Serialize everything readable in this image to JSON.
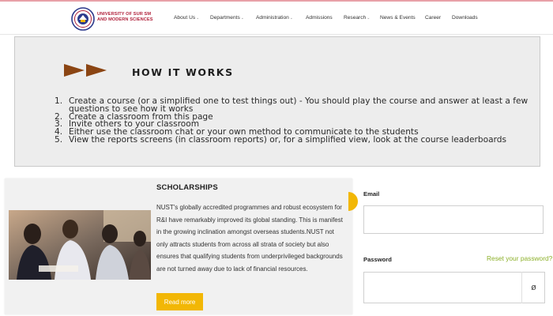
{
  "header": {
    "logo_text_line1": "UNIVERSITY OF SUR SM",
    "logo_text_line2": "AND MODERN SCIENCES",
    "nav": [
      {
        "label": "About Us",
        "has_menu": true
      },
      {
        "label": "Departments",
        "has_menu": true
      },
      {
        "label": "Administration",
        "has_menu": true
      },
      {
        "label": "Admissions",
        "has_menu": false
      },
      {
        "label": "Research",
        "has_menu": true
      },
      {
        "label": "News & Events",
        "has_menu": false
      },
      {
        "label": "Career",
        "has_menu": false
      },
      {
        "label": "Downloads",
        "has_menu": false
      }
    ]
  },
  "how_it_works": {
    "title": "HOW IT WORKS",
    "steps": [
      {
        "num": "1.",
        "text": "Create a course (or a simplified one to test things out) - You should play the course and answer at least a few questions to see how it works"
      },
      {
        "num": "2.",
        "text": "Create a classroom from this page"
      },
      {
        "num": "3.",
        "text": "Invite others to your classroom"
      },
      {
        "num": "4.",
        "text": "Either use the classroom chat or your own method to communicate to the students"
      },
      {
        "num": "5.",
        "text": "View the reports screens (in classroom reports) or, for a simplified view, look at the course leaderboards"
      }
    ]
  },
  "scholarships": {
    "title": "SCHOLARSHIPS",
    "body": "NUST's globally accredited programmes and robust ecosystem for R&I have remarkably improved its global standing. This is manifest in the growing inclination amongst overseas students.NUST not only attracts students from across all strata of society but also ensures that qualifying students from underprivileged backgrounds are not turned away due to lack of financial resources.",
    "button_label": "Read more"
  },
  "login": {
    "email_label": "Email",
    "email_value": "",
    "password_label": "Password",
    "password_value": "",
    "reset_link": "Reset your password?",
    "toggle_icon": "eye-slash-icon"
  },
  "colors": {
    "accent_yellow": "#f2b705",
    "link_green": "#8cb02a",
    "brand_red": "#b0203a",
    "arrow_brown": "#8b4513"
  }
}
